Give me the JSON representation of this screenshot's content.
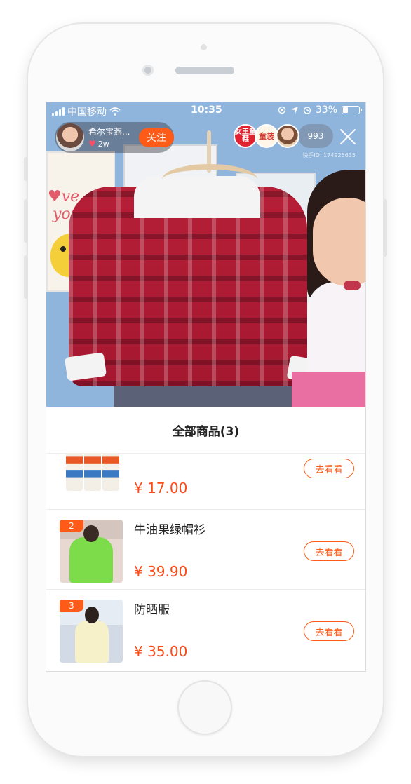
{
  "status_bar": {
    "carrier": "中国移动",
    "time": "10:35",
    "battery_percent": "33%",
    "battery_level": 0.33
  },
  "streamer": {
    "name": "希尔宝燕...",
    "likes": "2w",
    "follow_label": "关注"
  },
  "viewers": {
    "badge1_text": "女王童鞋",
    "badge2_text": "童装",
    "count": "993",
    "kwai_id": "快手ID: 174925635"
  },
  "panel": {
    "title": "全部商品(3)"
  },
  "products": [
    {
      "rank": "",
      "name": "",
      "price": "¥ 17.00",
      "button": "去看看"
    },
    {
      "rank": "2",
      "name": "牛油果绿帽衫",
      "price": "¥ 39.90",
      "button": "去看看"
    },
    {
      "rank": "3",
      "name": "防晒服",
      "price": "¥ 35.00",
      "button": "去看看"
    }
  ],
  "colors": {
    "accent": "#fe5a18",
    "price": "#fe4a16"
  },
  "icons": [
    "signal-icon",
    "wifi-icon",
    "location-icon",
    "alarm-icon",
    "battery-icon",
    "heart-icon",
    "close-icon"
  ]
}
